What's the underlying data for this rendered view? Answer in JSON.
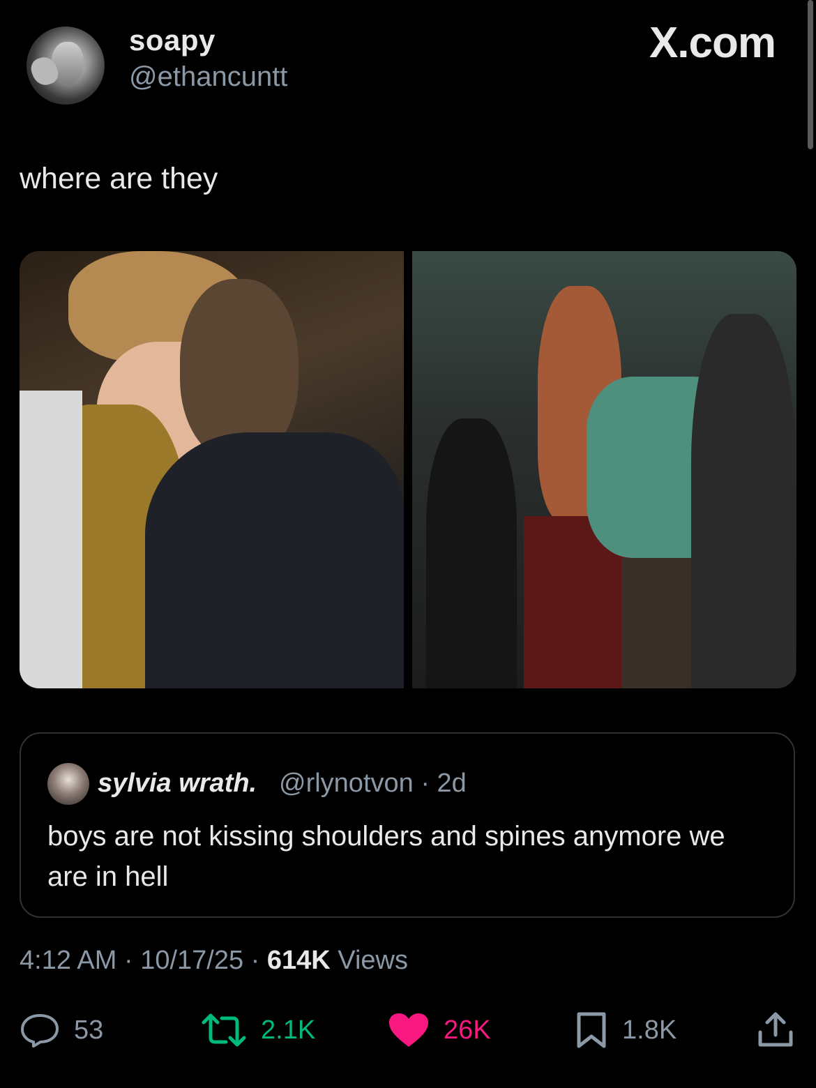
{
  "header": {
    "display_name": "soapy",
    "handle": "@ethancuntt",
    "brand": "X.com"
  },
  "tweet": {
    "text": "where are they"
  },
  "media": {
    "count": 2
  },
  "quote": {
    "name": "sylvia wrath.",
    "handle_time": "@rlynotvon · 2d",
    "text": "boys are not kissing shoulders and spines anymore we are in hell"
  },
  "meta": {
    "time_date": "4:12 AM · 10/17/25 · ",
    "views_count": "614K",
    "views_label": " Views"
  },
  "actions": {
    "replies": "53",
    "reposts": "2.1K",
    "likes": "26K",
    "bookmarks": "1.8K"
  },
  "colors": {
    "background": "#000000",
    "text": "#e7e9ea",
    "secondary": "#8b98a5",
    "repost_active": "#00ba7c",
    "like_active": "#f91880",
    "border": "#2f3336"
  },
  "icons": {
    "reply": "reply-bubble-icon",
    "repost": "repost-arrows-icon",
    "like": "heart-icon",
    "bookmark": "bookmark-icon",
    "share": "share-upload-icon"
  }
}
